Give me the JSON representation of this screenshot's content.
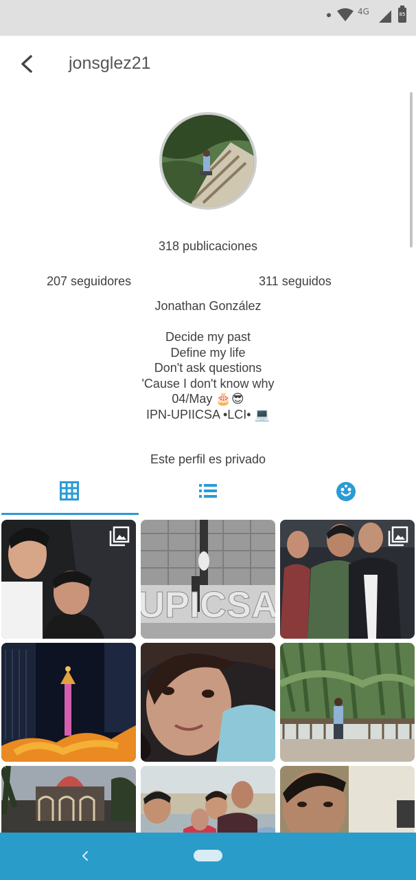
{
  "status_bar": {
    "network": "4G",
    "battery": "85",
    "icons": [
      "notification-dot-icon",
      "wifi-icon",
      "signal-icon",
      "battery-icon"
    ]
  },
  "header": {
    "back_icon": "chevron-left-icon",
    "username": "jonsglez21"
  },
  "profile": {
    "posts": "318 publicaciones",
    "followers": "207  seguidores",
    "following": "311  seguidos",
    "full_name": "Jonathan González",
    "bio": [
      "Decide my past",
      "Define my life",
      "Don't ask questions",
      "'Cause I don't know why",
      "04/May 🎂😎",
      "IPN-UPIICSA •LCI• 💻"
    ],
    "private_notice": "Este perfil es privado"
  },
  "tabs": [
    {
      "icon": "grid-icon",
      "selected": true
    },
    {
      "icon": "list-icon",
      "selected": false
    },
    {
      "icon": "tagged-face-icon",
      "selected": false
    }
  ],
  "grid_photos": [
    {
      "name": "photo-selfie-duo",
      "multiple": true
    },
    {
      "name": "photo-upiicsa-sign",
      "multiple": false
    },
    {
      "name": "photo-friends-group",
      "multiple": true
    },
    {
      "name": "photo-angel-monument-night",
      "multiple": false
    },
    {
      "name": "photo-girl-selfie",
      "multiple": false
    },
    {
      "name": "photo-garden-bridge",
      "multiple": false
    },
    {
      "name": "photo-kiosk-building",
      "multiple": false
    },
    {
      "name": "photo-group-outdoor",
      "multiple": false
    },
    {
      "name": "photo-selfie-office",
      "multiple": false
    }
  ],
  "colors": {
    "accent": "#2a9bd6",
    "nav_bar": "#2a9cc9",
    "status_bar": "#e0e0e0"
  },
  "nav_bar": {
    "icons": [
      "nav-back-icon",
      "home-pill-icon"
    ]
  }
}
